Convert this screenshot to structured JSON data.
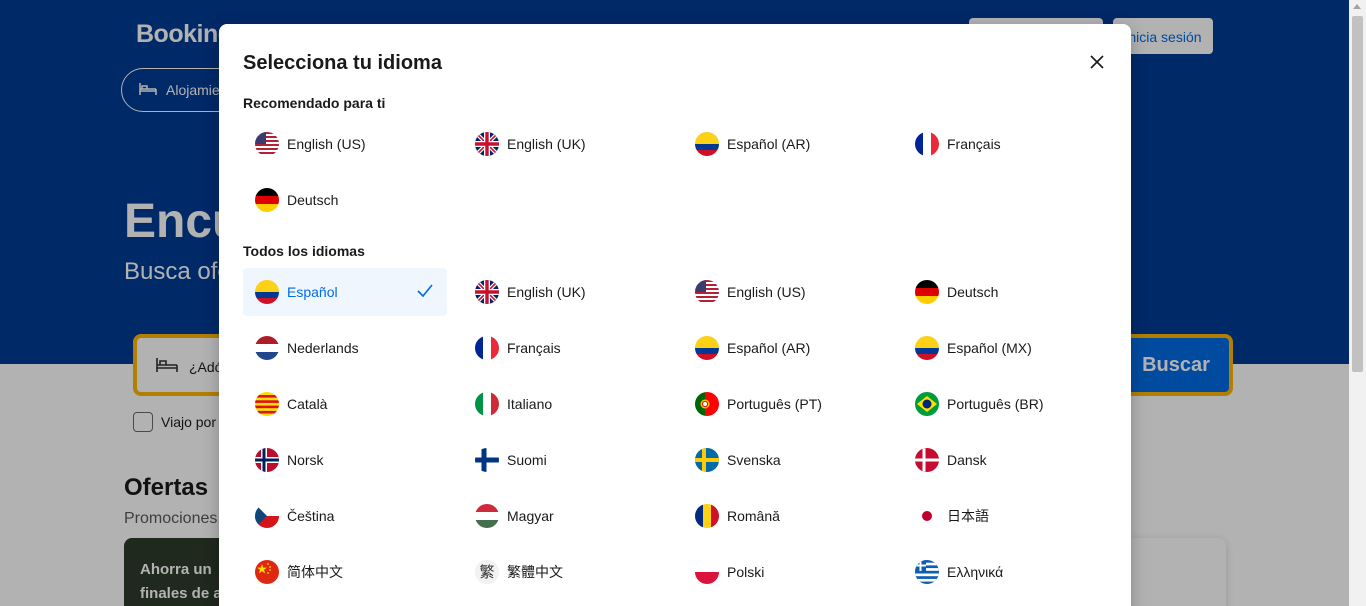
{
  "background": {
    "logo": "Booking",
    "register_label": "",
    "login_label": "Inicia sesión",
    "nav_stays": "Alojamie",
    "hero_title": "Encu",
    "hero_subtitle": "Busca ofe",
    "search_placeholder": "¿Adó",
    "search_button": "Buscar",
    "work_trip_label": "Viajo por",
    "offers_title": "Ofertas",
    "offers_subtitle": "Promociones,",
    "offer_card_line1": "Ahorra un",
    "offer_card_line2": "finales de a"
  },
  "modal": {
    "title": "Selecciona tu idioma",
    "recommended_title": "Recomendado para ti",
    "all_title": "Todos los idiomas",
    "recommended": [
      {
        "label": "English (US)",
        "flag": "us"
      },
      {
        "label": "English (UK)",
        "flag": "uk"
      },
      {
        "label": "Español (AR)",
        "flag": "co"
      },
      {
        "label": "Français",
        "flag": "fr"
      },
      {
        "label": "Deutsch",
        "flag": "de"
      }
    ],
    "all": [
      {
        "label": "Español",
        "flag": "co",
        "selected": true
      },
      {
        "label": "English (UK)",
        "flag": "uk"
      },
      {
        "label": "English (US)",
        "flag": "us"
      },
      {
        "label": "Deutsch",
        "flag": "de"
      },
      {
        "label": "Nederlands",
        "flag": "nl"
      },
      {
        "label": "Français",
        "flag": "fr"
      },
      {
        "label": "Español (AR)",
        "flag": "co"
      },
      {
        "label": "Español (MX)",
        "flag": "co"
      },
      {
        "label": "Català",
        "flag": "cat"
      },
      {
        "label": "Italiano",
        "flag": "it"
      },
      {
        "label": "Português (PT)",
        "flag": "pt"
      },
      {
        "label": "Português (BR)",
        "flag": "br"
      },
      {
        "label": "Norsk",
        "flag": "no"
      },
      {
        "label": "Suomi",
        "flag": "fi"
      },
      {
        "label": "Svenska",
        "flag": "se"
      },
      {
        "label": "Dansk",
        "flag": "dk"
      },
      {
        "label": "Čeština",
        "flag": "cz"
      },
      {
        "label": "Magyar",
        "flag": "hu"
      },
      {
        "label": "Română",
        "flag": "ro"
      },
      {
        "label": "日本語",
        "flag": "jp"
      },
      {
        "label": "简体中文",
        "flag": "cn"
      },
      {
        "label": "繁體中文",
        "flag": "tw"
      },
      {
        "label": "Polski",
        "flag": "pl"
      },
      {
        "label": "Ελληνικά",
        "flag": "gr"
      }
    ]
  },
  "colors": {
    "brand_blue": "#003b95",
    "action_blue": "#006ce4",
    "highlight_yellow": "#ffb700",
    "selected_bg": "#f0f6fd"
  }
}
